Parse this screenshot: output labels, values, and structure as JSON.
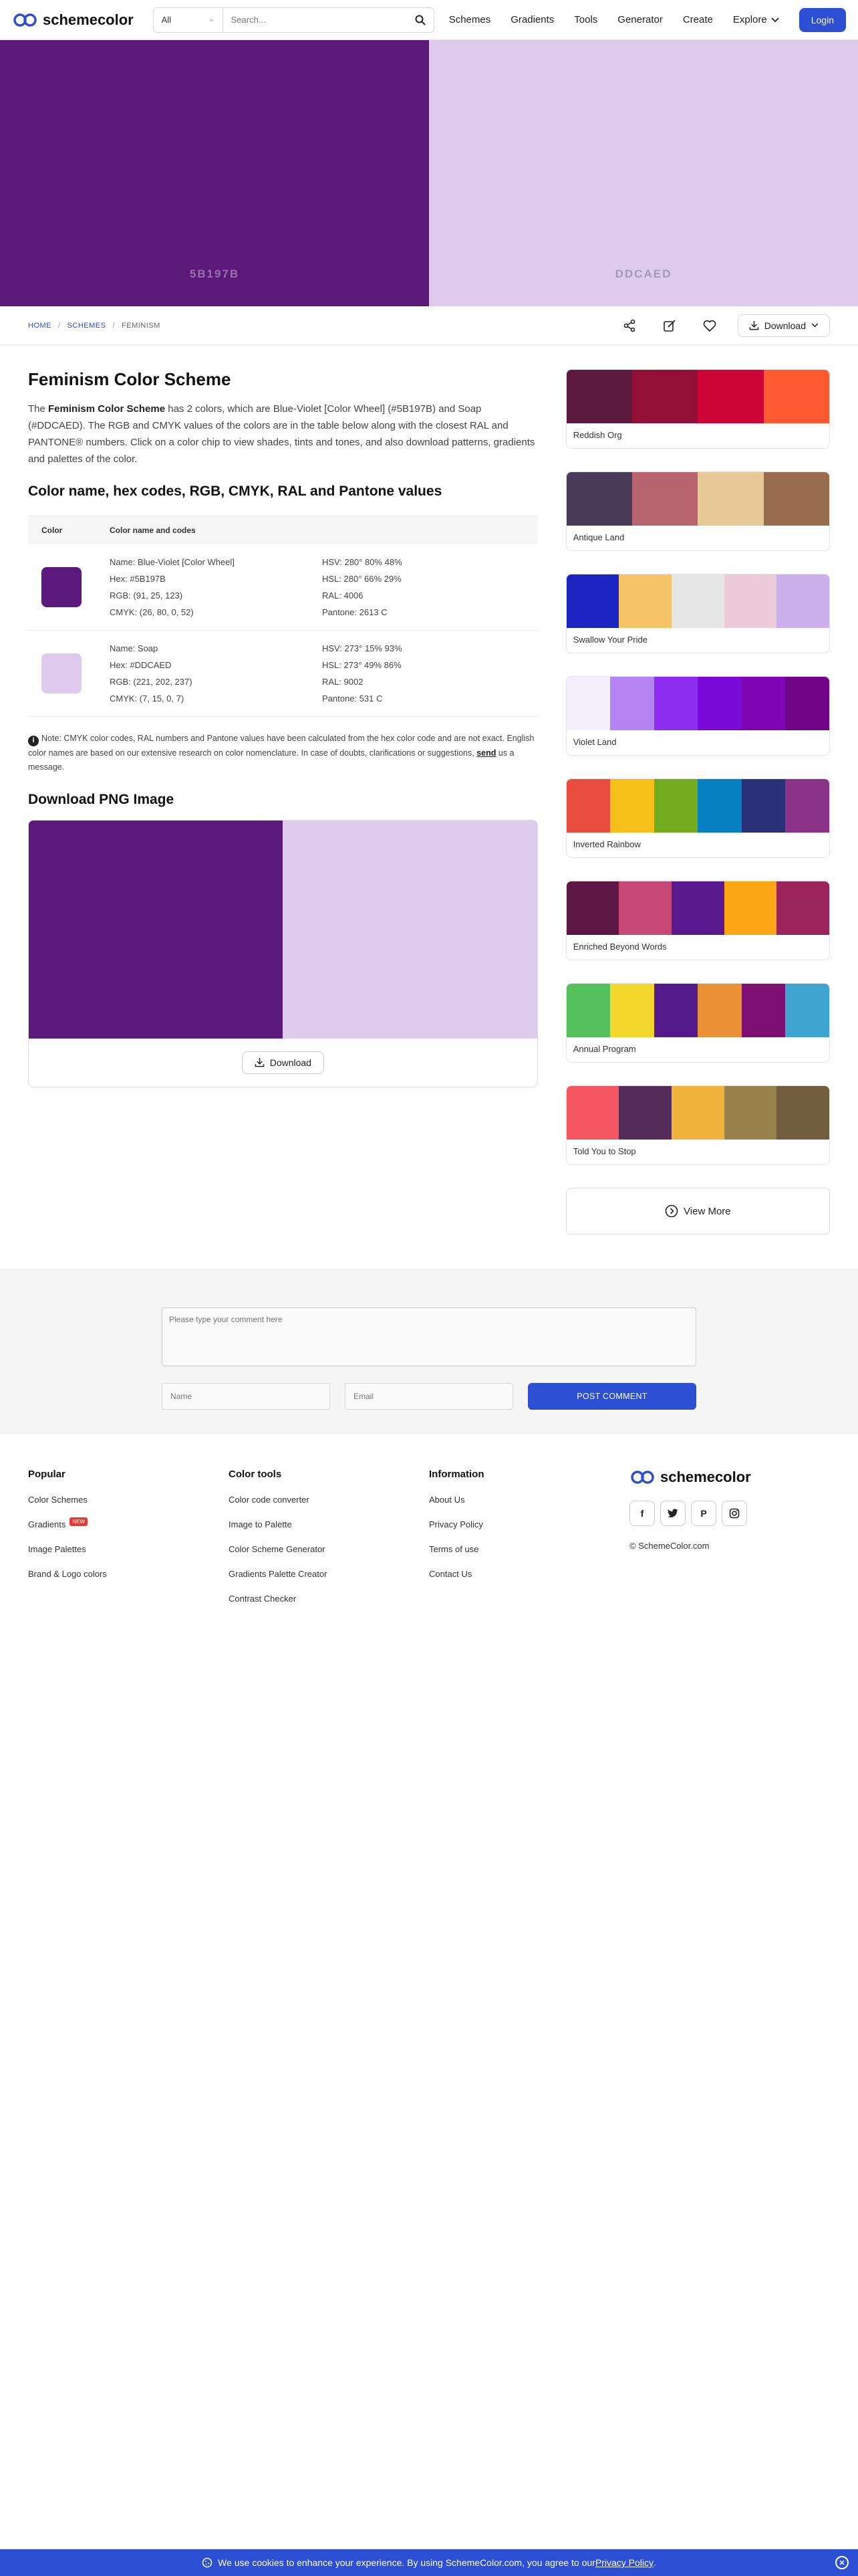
{
  "header": {
    "logo_text": "schemecolor",
    "search_select": "All",
    "search_placeholder": "Search...",
    "nav": [
      "Schemes",
      "Gradients",
      "Tools",
      "Generator",
      "Create",
      "Explore"
    ],
    "login": "Login"
  },
  "hero": {
    "left": {
      "hex": "#5B1978",
      "label": "5B197B",
      "text_color": "#9b6fb3"
    },
    "right": {
      "hex": "#DDCAED",
      "label": "DDCAED",
      "text_color": "#a898b8"
    }
  },
  "breadcrumb": {
    "home": "HOME",
    "schemes": "SCHEMES",
    "current": "FEMINISM"
  },
  "toolbar": {
    "download": "Download"
  },
  "main": {
    "title": "Feminism Color Scheme",
    "intro_pre": "The ",
    "intro_bold": "Feminism Color Scheme",
    "intro_post": " has 2 colors, which are Blue-Violet [Color Wheel] (#5B197B) and Soap (#DDCAED). The RGB and CMYK values of the colors are in the table below along with the closest RAL and PANTONE® numbers. Click on a color chip to view shades, tints and tones, and also download patterns, gradients and palettes of the color.",
    "table_title": "Color name, hex codes, RGB, CMYK, RAL and Pantone values",
    "table_head": {
      "color": "Color",
      "codes": "Color name and codes"
    },
    "rows": [
      {
        "chip": "#5B197B",
        "name": "Name: Blue-Violet [Color Wheel]",
        "hex": "Hex: #5B197B",
        "rgb": "RGB: (91, 25, 123)",
        "cmyk": "CMYK: (26, 80, 0, 52)",
        "hsv": "HSV: 280° 80% 48%",
        "hsl": "HSL: 280° 66% 29%",
        "ral": "RAL: 4006",
        "pantone": "Pantone: 2613 C"
      },
      {
        "chip": "#DDCAED",
        "name": "Name: Soap",
        "hex": "Hex: #DDCAED",
        "rgb": "RGB: (221, 202, 237)",
        "cmyk": "CMYK: (7, 15, 0, 7)",
        "hsv": "HSV: 273° 15% 93%",
        "hsl": "HSL: 273° 49% 86%",
        "ral": "RAL: 9002",
        "pantone": "Pantone: 531 C"
      }
    ],
    "note_pre": "Note: CMYK color codes, RAL numbers and Pantone values have been calculated from the hex color code and are not exact. English color names are based on our extensive research on color nomenclature. In case of doubts, clarifications or suggestions, ",
    "note_link": "send",
    "note_post": " us a message.",
    "png_title": "Download PNG Image",
    "png_download": "Download"
  },
  "sidebar": {
    "palettes": [
      {
        "name": "Reddish Org",
        "colors": [
          "#5c1a3f",
          "#930f35",
          "#cc0536",
          "#fd5a31"
        ]
      },
      {
        "name": "Antique Land",
        "colors": [
          "#4a3a59",
          "#b8646f",
          "#e8c896",
          "#986d4d"
        ]
      },
      {
        "name": "Swallow Your Pride",
        "colors": [
          "#1a24c1",
          "#f6c466",
          "#e6e6e6",
          "#eccbd9",
          "#c9b0e8"
        ]
      },
      {
        "name": "Violet Land",
        "colors": [
          "#f3effd",
          "#b583f2",
          "#8b2ef0",
          "#7a0ad8",
          "#7f06b5",
          "#710587"
        ]
      },
      {
        "name": "Inverted Rainbow",
        "colors": [
          "#e84c3c",
          "#f5c01a",
          "#71ad1f",
          "#0780c1",
          "#2b3178",
          "#8a3388"
        ]
      },
      {
        "name": "Enriched Beyond Words",
        "colors": [
          "#5d1845",
          "#c74874",
          "#5a1a8f",
          "#fca616",
          "#9a2459"
        ]
      },
      {
        "name": "Annual Program",
        "colors": [
          "#55c15d",
          "#f3d72d",
          "#541a8c",
          "#ea9135",
          "#7e0f72",
          "#40a4d1"
        ]
      },
      {
        "name": "Told You to Stop",
        "colors": [
          "#f45761",
          "#542d59",
          "#f2b33d",
          "#968148",
          "#6f5d3c"
        ]
      }
    ],
    "view_more": "View More"
  },
  "comments": {
    "placeholder": "Please type your comment here",
    "name": "Name",
    "email": "Email",
    "post": "POST COMMENT"
  },
  "footer": {
    "popular": {
      "title": "Popular",
      "links": [
        "Color Schemes",
        "Gradients",
        "Image Palettes",
        "Brand & Logo colors"
      ],
      "new_badge": "NEW"
    },
    "tools": {
      "title": "Color tools",
      "links": [
        "Color code converter",
        "Image to Palette",
        "Color Scheme Generator",
        "Gradients Palette Creator",
        "Contrast Checker"
      ]
    },
    "info": {
      "title": "Information",
      "links": [
        "About Us",
        "Privacy Policy",
        "Terms of use",
        "Contact Us"
      ]
    },
    "brand": {
      "logo_text": "schemecolor",
      "copyright": "© SchemeColor.com"
    }
  },
  "cookie": {
    "text": "We use cookies to enhance your experience. By using SchemeColor.com, you agree to our ",
    "link": "Privacy Policy",
    "end": "."
  }
}
